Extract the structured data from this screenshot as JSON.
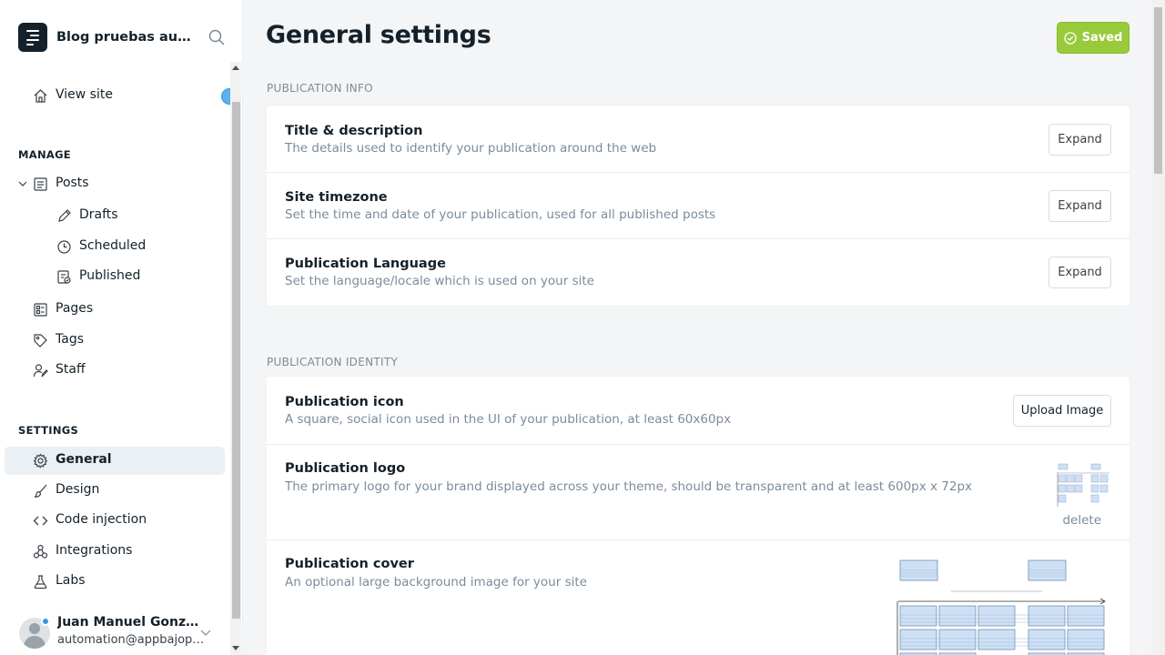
{
  "sidebar": {
    "site_title": "Blog pruebas auto...",
    "view_site": "View site",
    "manage_heading": "MANAGE",
    "manage_items": {
      "posts": "Posts",
      "drafts": "Drafts",
      "scheduled": "Scheduled",
      "published": "Published",
      "pages": "Pages",
      "tags": "Tags",
      "staff": "Staff"
    },
    "settings_heading": "SETTINGS",
    "settings_items": {
      "general": "General",
      "design": "Design",
      "code_injection": "Code injection",
      "integrations": "Integrations",
      "labs": "Labs"
    },
    "user": {
      "name": "Juan Manuel Gonzále...",
      "email": "automation@appbajopru..."
    }
  },
  "main": {
    "title": "General settings",
    "saved_label": "Saved",
    "publication_info": {
      "heading": "PUBLICATION INFO",
      "rows": [
        {
          "title": "Title & description",
          "desc": "The details used to identify your publication around the web",
          "button": "Expand"
        },
        {
          "title": "Site timezone",
          "desc": "Set the time and date of your publication, used for all published posts",
          "button": "Expand"
        },
        {
          "title": "Publication Language",
          "desc": "Set the language/locale which is used on your site",
          "button": "Expand"
        }
      ]
    },
    "publication_identity": {
      "heading": "PUBLICATION IDENTITY",
      "icon": {
        "title": "Publication icon",
        "desc": "A square, social icon used in the UI of your publication, at least 60x60px",
        "button": "Upload Image"
      },
      "logo": {
        "title": "Publication logo",
        "desc": "The primary logo for your brand displayed across your theme, should be transparent and at least 600px x 72px",
        "delete": "delete"
      },
      "cover": {
        "title": "Publication cover",
        "desc": "An optional large background image for your site"
      }
    }
  },
  "colors": {
    "saved_green": "#99ca3c",
    "active_nav_bg": "#eaf0f4",
    "muted_text": "#7c8b9a"
  }
}
